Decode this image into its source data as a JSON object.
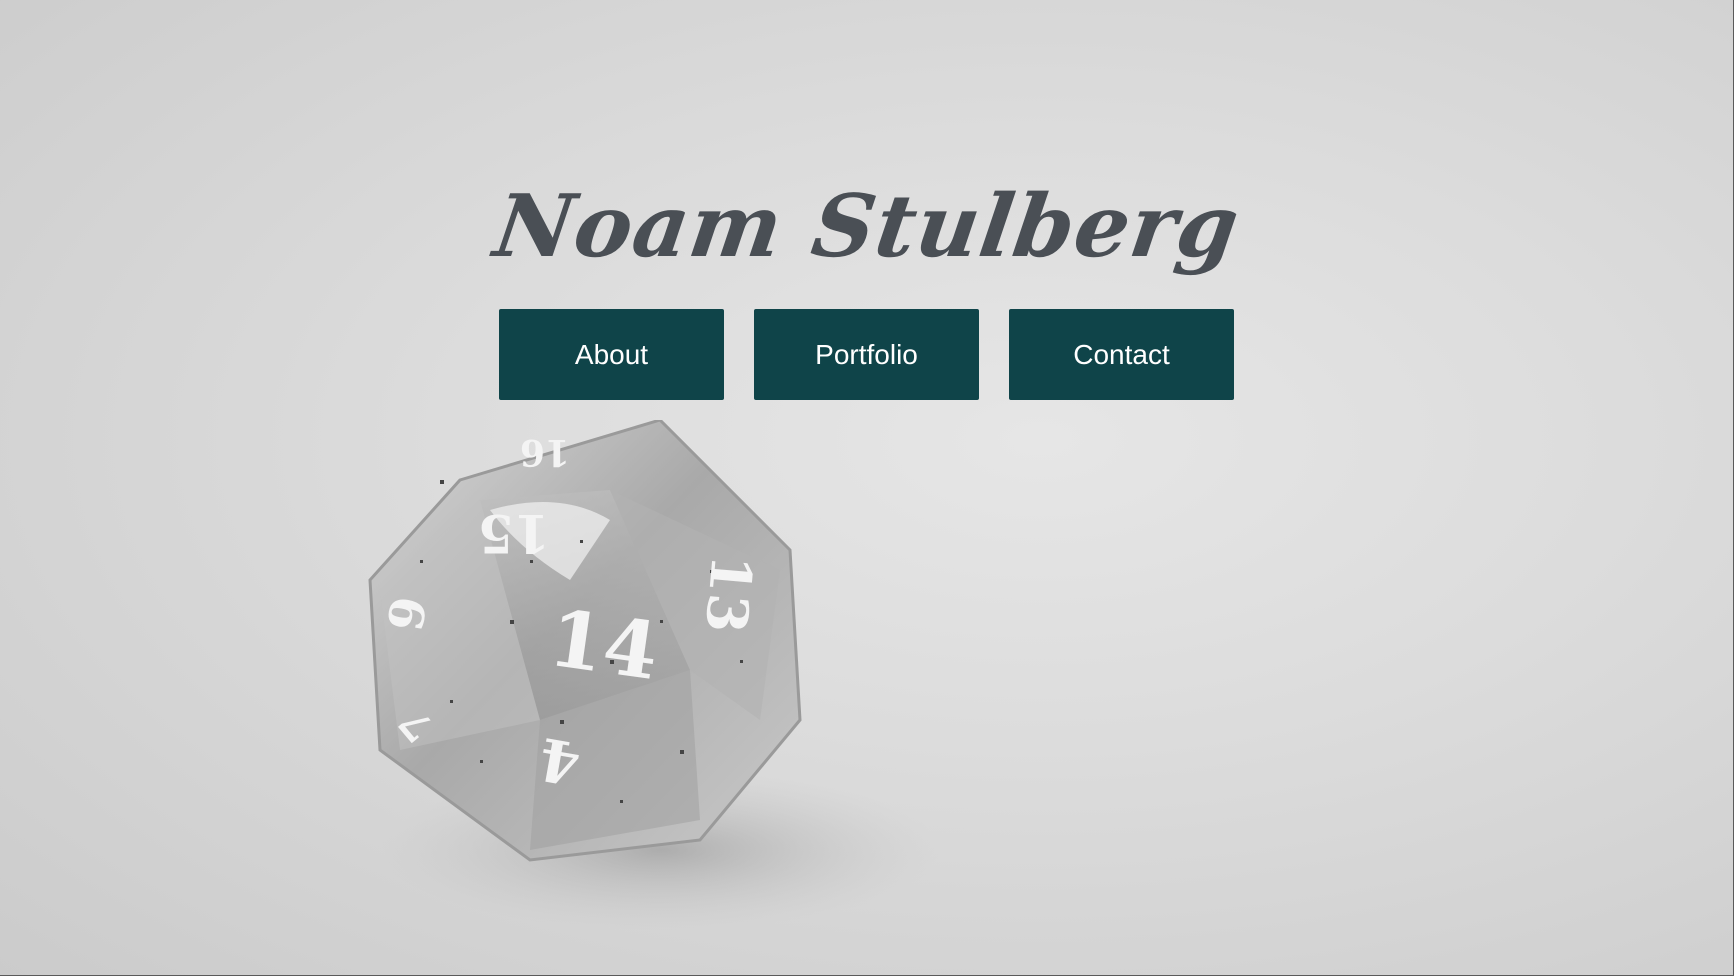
{
  "header": {
    "title": "Noam Stulberg"
  },
  "nav": {
    "items": [
      {
        "label": "About"
      },
      {
        "label": "Portfolio"
      },
      {
        "label": "Contact"
      }
    ]
  },
  "hero_image": {
    "die_numbers": [
      "16",
      "15",
      "13",
      "14",
      "9",
      "7",
      "4"
    ]
  },
  "colors": {
    "button_bg": "#0f4449",
    "title": "#4a4f55",
    "background": "#dcdcdc"
  }
}
